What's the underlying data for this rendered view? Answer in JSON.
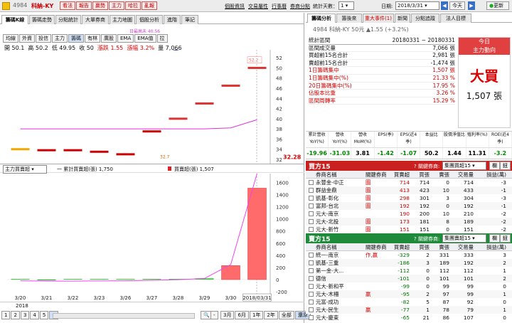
{
  "topbar": {
    "stock_code": "4984",
    "stock_name": "科納-KY",
    "buttons": [
      "看法",
      "報告",
      "贏勢",
      "主力",
      "哈拉",
      "亂報"
    ],
    "links": [
      "個股資訊",
      "交易屬性",
      "行事曆",
      "券商分點"
    ],
    "stat_days_label": "統計天數：",
    "stat_days_value": "1",
    "date_label": "日期:",
    "date_value": "2018/3/31",
    "today_btn": "今天",
    "update_btn": "更新"
  },
  "left": {
    "tabs": [
      "籌碼K線",
      "籌碼走勢",
      "分點統計",
      "大單券商",
      "主力地圖",
      "個股分析",
      "進階",
      "筆記"
    ],
    "subtabs": [
      "均線",
      "外資",
      "投信",
      "主力",
      "籌碼",
      "有林",
      "廣股",
      "EMA",
      "EMA值",
      ""
    ],
    "subtabs_labels": [
      "均線",
      "外資",
      "投信",
      "主力",
      "籌碼",
      "有林",
      "廣股",
      "EMA",
      "EMA值",
      "拉"
    ],
    "ohlc": {
      "open": "開 50.1",
      "high": "高 50.2",
      "low": "低 49.95",
      "close": "收 50",
      "chg": "漲跌 1.55",
      "pct": "漲幅 3.2%",
      "vol": "量 7,066"
    },
    "annotation": "日最高未 40.56",
    "price_label_52": "52.2",
    "price_last": "32.28",
    "low_label": "32.7",
    "y1_ticks": [
      "52",
      "50",
      "48",
      "46",
      "44",
      "42",
      "40",
      "38",
      "36",
      "34",
      "32"
    ],
    "lower_select": "主力買賣超",
    "legend1": "一 累計買賣超(張) 1,750",
    "legend2": "買賣超(張) 1,507",
    "y2_ticks": [
      "1600",
      "1400",
      "1200",
      "1000",
      "800",
      "600",
      "400",
      "200",
      "0",
      "-200"
    ],
    "x_ticks": [
      "3/20",
      "3/21",
      "3/22",
      "3/23",
      "3/26",
      "3/27",
      "3/28",
      "3/29",
      "3/30",
      "2018/03/31"
    ],
    "x_year": "2018",
    "bottom_buttons": [
      "1",
      "2",
      "3",
      "4",
      "5",
      "6"
    ],
    "bottom_right": [
      "3月",
      "6月",
      "1年",
      "2年",
      "全部",
      "還原"
    ]
  },
  "right": {
    "tabs": [
      "籌碼分析",
      "籌後來",
      "重大事件(1)",
      "新聞",
      "分點追蹤",
      "法人目標"
    ],
    "title": "4984 科納-KY 50元 ▲1.55 (+3.2%)",
    "stats": [
      [
        "統計區間",
        "20180331 ~ 20180331"
      ],
      [
        "區間成交量",
        "7,066 張"
      ],
      [
        "買超前15名合計",
        "2,981 張"
      ],
      [
        "賣超前15名合計",
        "-1,474 張"
      ],
      [
        "1日籌碼集中",
        "1,507 張"
      ],
      [
        "1日籌碼集中(%)",
        "21.33 %"
      ],
      [
        "20日籌碼集中(%)",
        "17.95 %"
      ],
      [
        "佔股本比重",
        "3.26 %"
      ],
      [
        "區間周轉率",
        "15.29 %"
      ]
    ],
    "today_title": "今日",
    "today_sub": "主力動向",
    "today_big": "大買",
    "today_amount": "1,507 張",
    "metrics_headers": [
      "累計營收YoY(%)",
      "營收YoY(%)",
      "營收MoM(%)",
      "EPS(季)",
      "EPS(近4季)",
      "本益比",
      "股價淨值比",
      "殖利率(%)",
      "ROE(近4季)"
    ],
    "metrics_values": [
      "-19.96",
      "-31.03",
      "3.81",
      "-1.42",
      "-1.07",
      "50.2",
      "1.44",
      "11.31",
      "-3.2"
    ],
    "buy_title": "買方15",
    "buy_hint": "? 關鍵券商:",
    "buy_select": "集團買超15",
    "buy_btn1": "欄",
    "buy_btn2": "鈕",
    "table_headers": [
      "券商名稱",
      "關鍵券商",
      "買賣超",
      "買張",
      "賣張",
      "交易量",
      "損益(萬)"
    ],
    "buy_rows": [
      [
        "永豐金-中正",
        "圖",
        "714",
        "714",
        "0",
        "714",
        "-3"
      ],
      [
        "群益金鼎",
        "圖",
        "413",
        "423",
        "10",
        "433",
        "-1"
      ],
      [
        "凱基-彰化",
        "圖",
        "298",
        "301",
        "3",
        "304",
        "-3"
      ],
      [
        "富邦-台北",
        "圖",
        "192",
        "192",
        "0",
        "192",
        "-1"
      ],
      [
        "元大-南京",
        "",
        "190",
        "200",
        "10",
        "210",
        "-2"
      ],
      [
        "元大-北投",
        "圖",
        "173",
        "181",
        "8",
        "189",
        "-2"
      ],
      [
        "元大-新竹",
        "圖",
        "151",
        "151",
        "0",
        "151",
        "-2"
      ],
      [
        "富邦-嘉義",
        "",
        "124",
        "130",
        "6",
        "136",
        "-1"
      ],
      [
        "元大-基本",
        "",
        "114",
        "114",
        "0",
        "114",
        "-1"
      ]
    ],
    "sell_title": "賣方15",
    "sell_hint": "? 關鍵券商:",
    "sell_select": "集團賣超15",
    "sell_rows": [
      [
        "統一-南京",
        "作,嬴",
        "-329",
        "2",
        "331",
        "333",
        "3"
      ],
      [
        "凱基-三重",
        "",
        "-186",
        "3",
        "189",
        "192",
        "2"
      ],
      [
        "第一金-大...",
        "",
        "-112",
        "0",
        "112",
        "112",
        "1"
      ],
      [
        "德信",
        "",
        "-101",
        "0",
        "101",
        "101",
        "2"
      ],
      [
        "元大-新和平",
        "",
        "-99",
        "0",
        "99",
        "99",
        "0"
      ],
      [
        "元大-木柵",
        "嬴",
        "-95",
        "2",
        "97",
        "99",
        "1"
      ],
      [
        "元富-成功",
        "",
        "-82",
        "5",
        "87",
        "92",
        "0"
      ],
      [
        "元大-民生",
        "嬴",
        "-77",
        "1",
        "78",
        "79",
        "1"
      ],
      [
        "元大-慶東",
        "",
        "-65",
        "21",
        "86",
        "107",
        "0"
      ]
    ]
  },
  "chart_data": [
    {
      "type": "candlestick",
      "title": "",
      "series_name": "price",
      "x": [
        "3/20",
        "3/21",
        "3/22",
        "3/23",
        "3/26",
        "3/27",
        "3/28",
        "3/29",
        "3/30",
        "2018/03/31"
      ],
      "close": [
        34.0,
        33.8,
        33.8,
        33.5,
        33.0,
        37.5,
        40.0,
        43.0,
        46.5,
        50.0
      ],
      "ylim": [
        32,
        53
      ]
    },
    {
      "type": "bar",
      "series": [
        {
          "name": "買賣超(張)",
          "values": [
            0,
            -5,
            0,
            3,
            2,
            8,
            10,
            20,
            230,
            1507
          ]
        },
        {
          "name": "累計買賣超(張)",
          "values": [
            -20,
            -25,
            -25,
            -22,
            -20,
            -12,
            -2,
            18,
            248,
            1750
          ]
        }
      ],
      "x": [
        "3/20",
        "3/21",
        "3/22",
        "3/23",
        "3/26",
        "3/27",
        "3/28",
        "3/29",
        "3/30",
        "2018/03/31"
      ],
      "ylim": [
        -200,
        1700
      ]
    }
  ]
}
